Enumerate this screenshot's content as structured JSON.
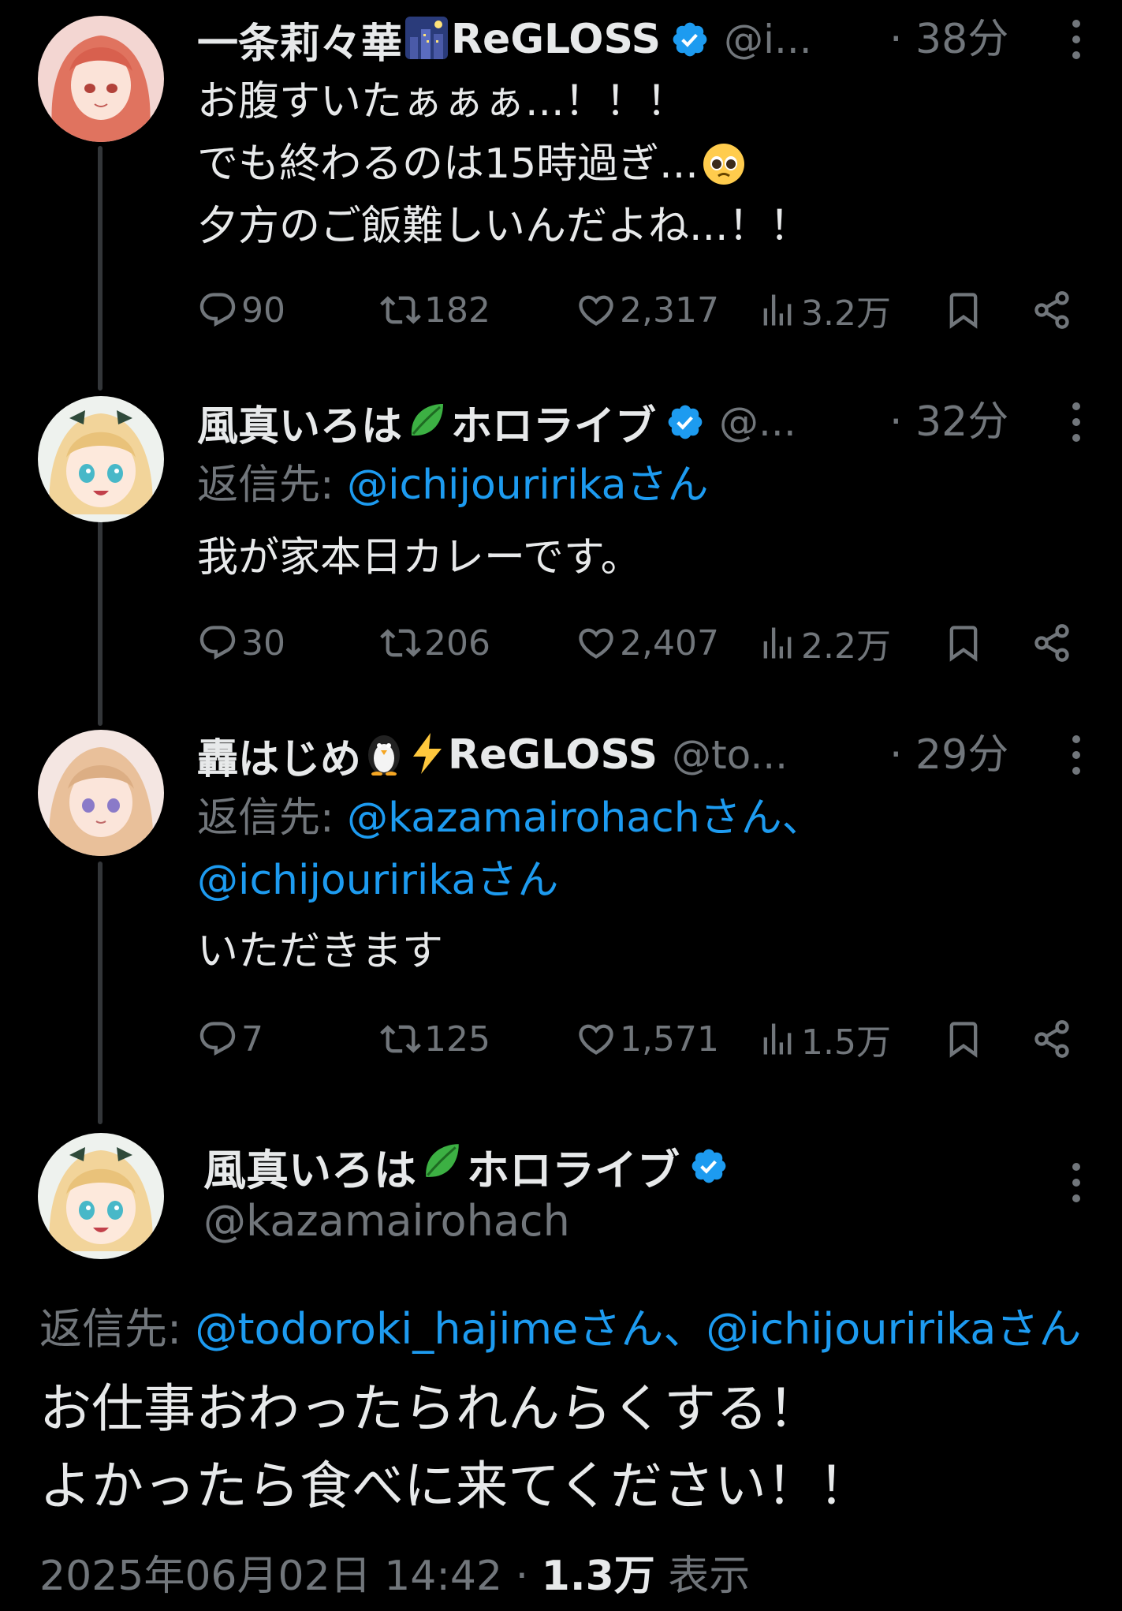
{
  "tweet1": {
    "name": "一条莉々華",
    "name_suffix": "ReGLOSS",
    "handle": "@i...",
    "time": "· 38分",
    "lines": [
      "お腹すいたぁぁぁ...！！！",
      "でも終わるのは15時過ぎ...",
      "夕方のご飯難しいんだよね...！！"
    ],
    "replies": "90",
    "retweets": "182",
    "likes": "2,317",
    "views": "3.2万"
  },
  "tweet2": {
    "name": "風真いろは",
    "name_suffix": "ホロライブ",
    "handle": "@...",
    "time": "· 32分",
    "reply_label": "返信先: ",
    "reply_to": "@ichijouririkaさん",
    "text": "我が家本日カレーです。",
    "replies": "30",
    "retweets": "206",
    "likes": "2,407",
    "views": "2.2万"
  },
  "tweet3": {
    "name": "轟はじめ",
    "name_suffix": "ReGLOSS",
    "handle": "@to...",
    "time": "· 29分",
    "reply_label": "返信先: ",
    "reply_to_1": "@kazamairohachさん、",
    "reply_to_2": "@ichijouririkaさん",
    "text": "いただきます",
    "replies": "7",
    "retweets": "125",
    "likes": "1,571",
    "views": "1.5万"
  },
  "main": {
    "name": "風真いろは",
    "name_suffix": "ホロライブ",
    "handle": "@kazamairohach",
    "reply_label": "返信先: ",
    "reply_to_1": "@todoroki_hajimeさん",
    "reply_sep": "、",
    "reply_to_2": "@ichijouririkaさん",
    "line1": "お仕事おわったられんらくする！",
    "line2": "よかったら食べに来てください！！",
    "date": "2025年06月02日 14:42 · ",
    "views_count": "1.3万",
    "views_label": " 表示"
  },
  "colors": {
    "background": "#000000",
    "text": "#e7e9ea",
    "muted": "#71767b",
    "accent": "#1d9bf0"
  },
  "icons": [
    "reply-icon",
    "retweet-icon",
    "like-icon",
    "views-icon",
    "bookmark-icon",
    "share-icon",
    "verified-badge-icon",
    "more-icon"
  ]
}
